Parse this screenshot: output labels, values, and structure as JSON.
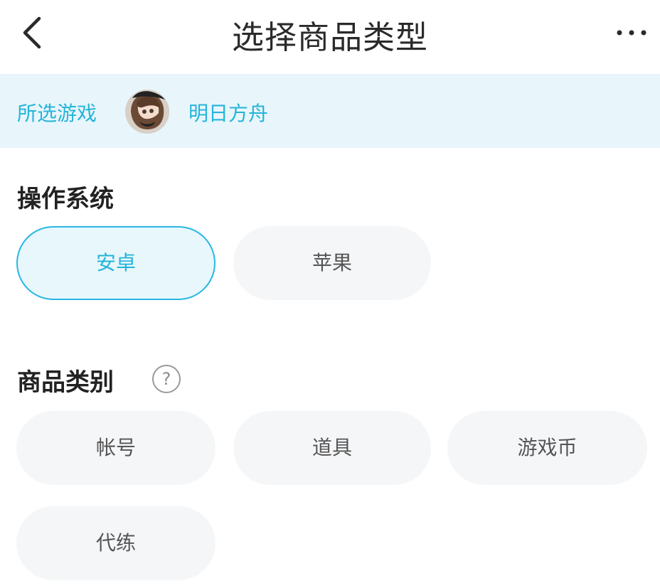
{
  "header": {
    "title": "选择商品类型",
    "back_icon": "chevron-left-icon",
    "more_icon": "more-horizontal-icon"
  },
  "game": {
    "label": "所选游戏",
    "name": "明日方舟",
    "avatar_icon": "game-avatar"
  },
  "os_section": {
    "title": "操作系统",
    "options": [
      "安卓",
      "苹果"
    ],
    "selected": "安卓"
  },
  "category_section": {
    "title": "商品类别",
    "help_icon": "question-circle-icon",
    "help_text": "?",
    "options": [
      "帐号",
      "道具",
      "游戏币",
      "代练"
    ]
  },
  "colors": {
    "accent": "#25b4d8",
    "banner_bg": "#e8f6fc",
    "chip_bg": "#f5f6f8"
  }
}
